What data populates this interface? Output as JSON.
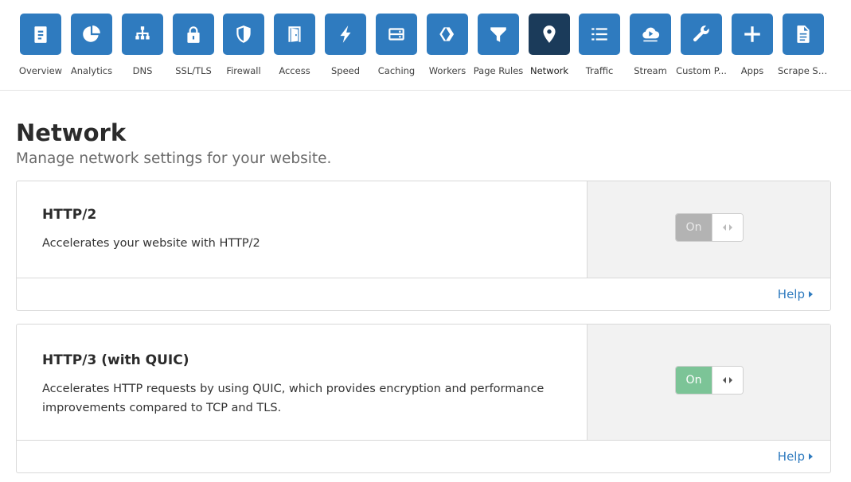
{
  "nav": {
    "items": [
      {
        "label": "Overview",
        "icon": "clipboard-icon"
      },
      {
        "label": "Analytics",
        "icon": "pie-chart-icon"
      },
      {
        "label": "DNS",
        "icon": "sitemap-icon"
      },
      {
        "label": "SSL/TLS",
        "icon": "lock-icon"
      },
      {
        "label": "Firewall",
        "icon": "shield-icon"
      },
      {
        "label": "Access",
        "icon": "door-icon"
      },
      {
        "label": "Speed",
        "icon": "lightning-icon"
      },
      {
        "label": "Caching",
        "icon": "server-icon"
      },
      {
        "label": "Workers",
        "icon": "workers-icon"
      },
      {
        "label": "Page Rules",
        "icon": "filter-icon"
      },
      {
        "label": "Network",
        "icon": "location-pin-icon"
      },
      {
        "label": "Traffic",
        "icon": "list-icon"
      },
      {
        "label": "Stream",
        "icon": "cloud-play-icon"
      },
      {
        "label": "Custom P...",
        "icon": "wrench-icon"
      },
      {
        "label": "Apps",
        "icon": "plus-icon"
      },
      {
        "label": "Scrape Shi...",
        "icon": "document-icon"
      }
    ],
    "active": "Network",
    "accent_color": "#2f7bbf",
    "active_color": "#1b3b5a"
  },
  "page": {
    "title": "Network",
    "subtitle": "Manage network settings for your website."
  },
  "settings": [
    {
      "title": "HTTP/2",
      "description": "Accelerates your website with HTTP/2",
      "toggle_label": "On",
      "toggle_state": "disabled",
      "help_label": "Help"
    },
    {
      "title": "HTTP/3 (with QUIC)",
      "description": "Accelerates HTTP requests by using QUIC, which provides encryption and performance improvements compared to TCP and TLS.",
      "toggle_label": "On",
      "toggle_state": "enabled",
      "help_label": "Help"
    }
  ],
  "colors": {
    "toggle_on": "#7cc497",
    "toggle_disabled": "#b3b3b3",
    "link": "#2f7bbf"
  }
}
